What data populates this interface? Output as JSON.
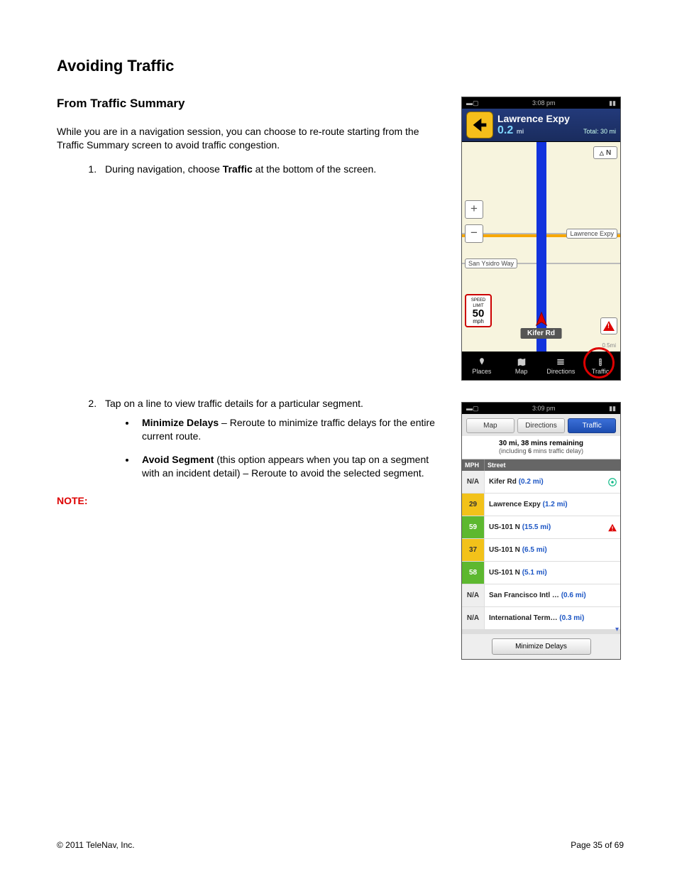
{
  "page": {
    "title": "Avoiding Traffic",
    "section": "From Traffic Summary",
    "intro": "While you are in a navigation session, you can choose to re-route starting from the Traffic Summary screen to avoid traffic congestion.",
    "step1_a": "During navigation, choose ",
    "step1_b": "Traffic",
    "step1_c": " at the bottom of the screen.",
    "step2": "Tap on a line to view traffic details for a particular segment.",
    "bullet1_b": "Minimize Delays",
    "bullet1_t": " – Reroute to minimize traffic delays for the entire current route.",
    "bullet2_b": "Avoid Segment",
    "bullet2_t": " (this option appears when you tap on a segment with an incident detail) – Reroute to avoid the selected segment.",
    "note": "NOTE:"
  },
  "nav": {
    "time": "3:08 pm",
    "street": "Lawrence Expy",
    "dist": "0.2",
    "dist_unit": "mi",
    "total": "Total: 30 mi",
    "compass": "N",
    "zoom_in": "+",
    "zoom_out": "−",
    "speed_label_top": "SPEED LIMIT",
    "speed_value": "50",
    "speed_label_bot": "mph",
    "label_lawrence": "Lawrence Expy",
    "label_sanysidro": "San Ysidro Way",
    "current_street": "Kifer Rd",
    "scale": "0.5mi",
    "tabs": {
      "places": "Places",
      "map": "Map",
      "directions": "Directions",
      "traffic": "Traffic"
    }
  },
  "traffic": {
    "time": "3:09 pm",
    "tab_map": "Map",
    "tab_dir": "Directions",
    "tab_traf": "Traffic",
    "remaining": "30 mi, 38 mins remaining",
    "remaining_sub_a": "(including ",
    "remaining_sub_b": "6",
    "remaining_sub_c": " mins traffic delay)",
    "col_mph": "MPH",
    "col_street": "Street",
    "rows": [
      {
        "mph": "N/A",
        "cls": "mph-na",
        "name": "Kifer Rd",
        "dist": "(0.2 mi)",
        "icon": "loc"
      },
      {
        "mph": "29",
        "cls": "mph-y",
        "name": "Lawrence Expy",
        "dist": "(1.2 mi)",
        "icon": ""
      },
      {
        "mph": "59",
        "cls": "mph-g",
        "name": "US-101 N",
        "dist": "(15.5 mi)",
        "icon": "warn"
      },
      {
        "mph": "37",
        "cls": "mph-y",
        "name": "US-101 N",
        "dist": "(6.5 mi)",
        "icon": ""
      },
      {
        "mph": "58",
        "cls": "mph-g",
        "name": "US-101 N",
        "dist": "(5.1 mi)",
        "icon": ""
      },
      {
        "mph": "N/A",
        "cls": "mph-na",
        "name": "San Francisco Intl …",
        "dist": "(0.6 mi)",
        "icon": ""
      },
      {
        "mph": "N/A",
        "cls": "mph-na",
        "name": "International Term…",
        "dist": "(0.3 mi)",
        "icon": ""
      }
    ],
    "minimize": "Minimize Delays"
  },
  "footer": {
    "copyright": "© 2011 TeleNav, Inc.",
    "page": "Page 35 of 69"
  }
}
